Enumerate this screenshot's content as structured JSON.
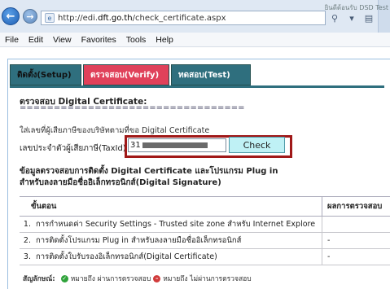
{
  "browser": {
    "url_prefix": "http://edi.",
    "url_domain": "dft.go.th",
    "url_path": "/check_certificate.aspx",
    "tab_title": "ยินดีต้อนรับ DSD Test"
  },
  "menu": {
    "items": [
      "File",
      "Edit",
      "View",
      "Favorites",
      "Tools",
      "Help"
    ]
  },
  "tabs": {
    "setup": "ติดตั้ง(Setup)",
    "verify": "ตรวจสอบ(Verify)",
    "test": "ทดสอบ(Test)"
  },
  "section": {
    "title": "ตรวจสอบ Digital Certificate:",
    "rule": "=================================",
    "instruction": "ใส่เลขที่ผู้เสียภาษีของบริษัทตามที่ขอ Digital Certificate",
    "taxid_label": "เลขประจำตัวผู้เสียภาษี(TaxId)",
    "taxid_value": "31",
    "check_label": "Check"
  },
  "info": {
    "title": "ข้อมูลตรวจสอบการติดตั้ง Digital Certificate และโปรแกรม Plug in สำหรับลงลายมือชื่ออิเล็กทรอนิกส์(Digital Signature)"
  },
  "table": {
    "col_step": "ขั้นตอน",
    "col_result": "ผลการตรวจสอบ",
    "rows": [
      {
        "num": "1.",
        "step": "การกำหนดค่า Security Settings - Trusted site zone สำหรับ Internet Explore",
        "result": ""
      },
      {
        "num": "2.",
        "step": "การติดตั้งโปรแกรม Plug in สำหรับลงลายมือชื่ออิเล็กทรอนิกส์",
        "result": "-"
      },
      {
        "num": "3.",
        "step": "การติดตั้งใบรับรองอิเล็กทรอนิกส์(Digital Certificate)",
        "result": "-"
      }
    ]
  },
  "legend": {
    "label": "สัญลักษณ์:",
    "pass_text": "หมายถึง ผ่านการตรวจสอบ",
    "fail_text": "หมายถึง ไม่ผ่านการตรวจสอบ"
  },
  "colors": {
    "tab_active": "#e0415a",
    "tab_inactive": "#2f6f7e",
    "highlight_border": "#a01818",
    "check_button": "#bff1f5"
  }
}
